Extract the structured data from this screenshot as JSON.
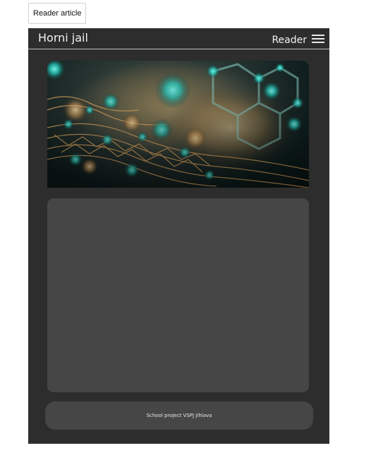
{
  "toolbar": {
    "reader_article_label": "Reader article"
  },
  "header": {
    "site_title": "Horni jail",
    "nav_label": "Reader",
    "menu_icon": "hamburger-menu-icon"
  },
  "hero": {
    "image_subject": "abstract molecular network with glowing teal nodes"
  },
  "footer": {
    "text": "School project VSPJ Jihlava"
  },
  "colors": {
    "page_background": "#ffffff",
    "app_background": "#2d2d2d",
    "card_background": "#464646",
    "text_light": "#f2f2f2",
    "accent_teal": "#2ad1c4",
    "accent_gold": "#e8b067"
  }
}
